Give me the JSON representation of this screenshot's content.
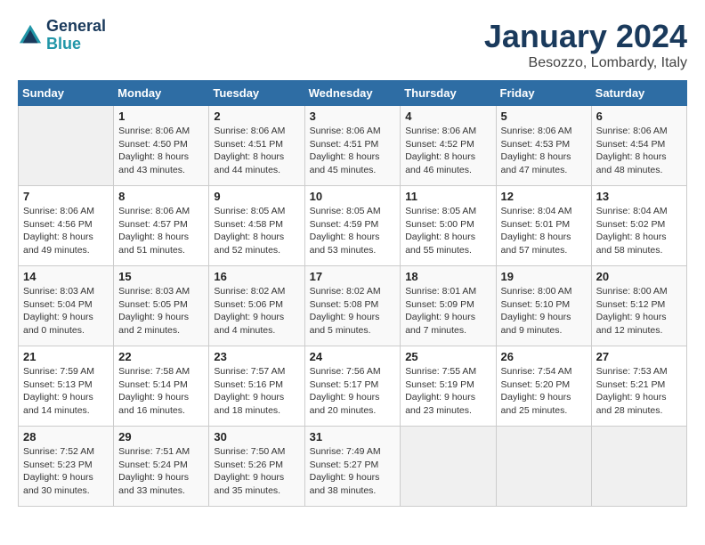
{
  "header": {
    "logo_line1": "General",
    "logo_line2": "Blue",
    "title": "January 2024",
    "subtitle": "Besozzo, Lombardy, Italy"
  },
  "weekdays": [
    "Sunday",
    "Monday",
    "Tuesday",
    "Wednesday",
    "Thursday",
    "Friday",
    "Saturday"
  ],
  "weeks": [
    [
      {
        "day": "",
        "info": ""
      },
      {
        "day": "1",
        "info": "Sunrise: 8:06 AM\nSunset: 4:50 PM\nDaylight: 8 hours\nand 43 minutes."
      },
      {
        "day": "2",
        "info": "Sunrise: 8:06 AM\nSunset: 4:51 PM\nDaylight: 8 hours\nand 44 minutes."
      },
      {
        "day": "3",
        "info": "Sunrise: 8:06 AM\nSunset: 4:51 PM\nDaylight: 8 hours\nand 45 minutes."
      },
      {
        "day": "4",
        "info": "Sunrise: 8:06 AM\nSunset: 4:52 PM\nDaylight: 8 hours\nand 46 minutes."
      },
      {
        "day": "5",
        "info": "Sunrise: 8:06 AM\nSunset: 4:53 PM\nDaylight: 8 hours\nand 47 minutes."
      },
      {
        "day": "6",
        "info": "Sunrise: 8:06 AM\nSunset: 4:54 PM\nDaylight: 8 hours\nand 48 minutes."
      }
    ],
    [
      {
        "day": "7",
        "info": "Sunrise: 8:06 AM\nSunset: 4:56 PM\nDaylight: 8 hours\nand 49 minutes."
      },
      {
        "day": "8",
        "info": "Sunrise: 8:06 AM\nSunset: 4:57 PM\nDaylight: 8 hours\nand 51 minutes."
      },
      {
        "day": "9",
        "info": "Sunrise: 8:05 AM\nSunset: 4:58 PM\nDaylight: 8 hours\nand 52 minutes."
      },
      {
        "day": "10",
        "info": "Sunrise: 8:05 AM\nSunset: 4:59 PM\nDaylight: 8 hours\nand 53 minutes."
      },
      {
        "day": "11",
        "info": "Sunrise: 8:05 AM\nSunset: 5:00 PM\nDaylight: 8 hours\nand 55 minutes."
      },
      {
        "day": "12",
        "info": "Sunrise: 8:04 AM\nSunset: 5:01 PM\nDaylight: 8 hours\nand 57 minutes."
      },
      {
        "day": "13",
        "info": "Sunrise: 8:04 AM\nSunset: 5:02 PM\nDaylight: 8 hours\nand 58 minutes."
      }
    ],
    [
      {
        "day": "14",
        "info": "Sunrise: 8:03 AM\nSunset: 5:04 PM\nDaylight: 9 hours\nand 0 minutes."
      },
      {
        "day": "15",
        "info": "Sunrise: 8:03 AM\nSunset: 5:05 PM\nDaylight: 9 hours\nand 2 minutes."
      },
      {
        "day": "16",
        "info": "Sunrise: 8:02 AM\nSunset: 5:06 PM\nDaylight: 9 hours\nand 4 minutes."
      },
      {
        "day": "17",
        "info": "Sunrise: 8:02 AM\nSunset: 5:08 PM\nDaylight: 9 hours\nand 5 minutes."
      },
      {
        "day": "18",
        "info": "Sunrise: 8:01 AM\nSunset: 5:09 PM\nDaylight: 9 hours\nand 7 minutes."
      },
      {
        "day": "19",
        "info": "Sunrise: 8:00 AM\nSunset: 5:10 PM\nDaylight: 9 hours\nand 9 minutes."
      },
      {
        "day": "20",
        "info": "Sunrise: 8:00 AM\nSunset: 5:12 PM\nDaylight: 9 hours\nand 12 minutes."
      }
    ],
    [
      {
        "day": "21",
        "info": "Sunrise: 7:59 AM\nSunset: 5:13 PM\nDaylight: 9 hours\nand 14 minutes."
      },
      {
        "day": "22",
        "info": "Sunrise: 7:58 AM\nSunset: 5:14 PM\nDaylight: 9 hours\nand 16 minutes."
      },
      {
        "day": "23",
        "info": "Sunrise: 7:57 AM\nSunset: 5:16 PM\nDaylight: 9 hours\nand 18 minutes."
      },
      {
        "day": "24",
        "info": "Sunrise: 7:56 AM\nSunset: 5:17 PM\nDaylight: 9 hours\nand 20 minutes."
      },
      {
        "day": "25",
        "info": "Sunrise: 7:55 AM\nSunset: 5:19 PM\nDaylight: 9 hours\nand 23 minutes."
      },
      {
        "day": "26",
        "info": "Sunrise: 7:54 AM\nSunset: 5:20 PM\nDaylight: 9 hours\nand 25 minutes."
      },
      {
        "day": "27",
        "info": "Sunrise: 7:53 AM\nSunset: 5:21 PM\nDaylight: 9 hours\nand 28 minutes."
      }
    ],
    [
      {
        "day": "28",
        "info": "Sunrise: 7:52 AM\nSunset: 5:23 PM\nDaylight: 9 hours\nand 30 minutes."
      },
      {
        "day": "29",
        "info": "Sunrise: 7:51 AM\nSunset: 5:24 PM\nDaylight: 9 hours\nand 33 minutes."
      },
      {
        "day": "30",
        "info": "Sunrise: 7:50 AM\nSunset: 5:26 PM\nDaylight: 9 hours\nand 35 minutes."
      },
      {
        "day": "31",
        "info": "Sunrise: 7:49 AM\nSunset: 5:27 PM\nDaylight: 9 hours\nand 38 minutes."
      },
      {
        "day": "",
        "info": ""
      },
      {
        "day": "",
        "info": ""
      },
      {
        "day": "",
        "info": ""
      }
    ]
  ]
}
